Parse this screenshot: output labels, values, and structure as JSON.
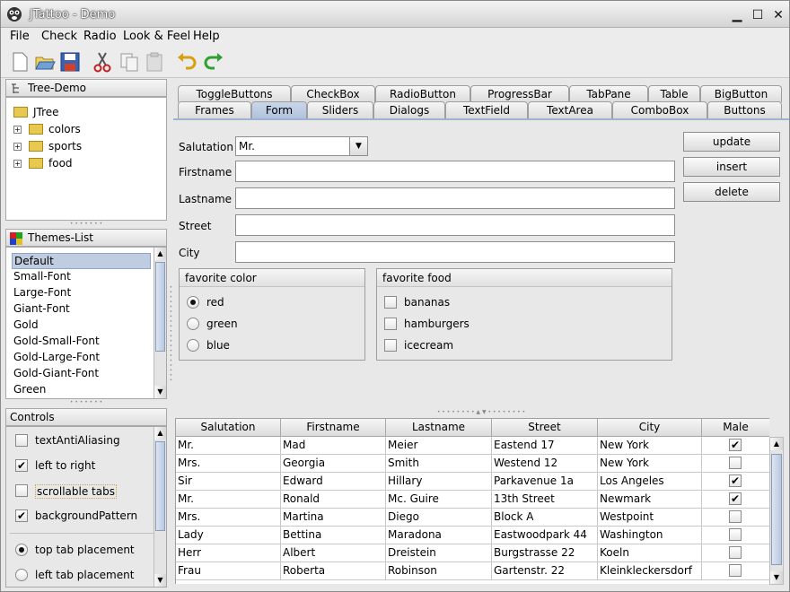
{
  "window": {
    "title": "JTattoo - Demo",
    "minimize": "▁",
    "maximize": "☐",
    "close": "✕"
  },
  "menubar": {
    "items": [
      "File",
      "Check",
      "Radio",
      "Look & Feel",
      "Help"
    ]
  },
  "toolbar": {
    "icons": [
      "new-file-icon",
      "open-folder-icon",
      "save-icon",
      "cut-icon",
      "copy-icon",
      "paste-icon",
      "undo-icon",
      "redo-icon"
    ]
  },
  "tree_panel": {
    "title": "Tree-Demo",
    "root": "JTree",
    "children": [
      "colors",
      "sports",
      "food"
    ],
    "expand_glyph": "+"
  },
  "themes_panel": {
    "title": "Themes-List",
    "items": [
      "Default",
      "Small-Font",
      "Large-Font",
      "Giant-Font",
      "Gold",
      "Gold-Small-Font",
      "Gold-Large-Font",
      "Gold-Giant-Font",
      "Green"
    ],
    "selected": "Default"
  },
  "controls_panel": {
    "title": "Controls",
    "checkboxes": [
      {
        "label": "textAntiAliasing",
        "checked": false,
        "mark": ""
      },
      {
        "label": "left to right",
        "checked": true,
        "mark": "✔"
      },
      {
        "label": "scrollable tabs",
        "checked": false,
        "mark": ""
      },
      {
        "label": "backgroundPattern",
        "checked": true,
        "mark": "✔"
      }
    ],
    "radios": [
      {
        "label": "top tab placement",
        "selected": true
      },
      {
        "label": "left tab placement",
        "selected": false
      }
    ]
  },
  "tabs": {
    "row1": [
      "ToggleButtons",
      "CheckBox",
      "RadioButton",
      "ProgressBar",
      "TabPane",
      "Table",
      "BigButton"
    ],
    "row2": [
      "Frames",
      "Form",
      "Sliders",
      "Dialogs",
      "TextField",
      "TextArea",
      "ComboBox",
      "Buttons"
    ],
    "selected": "Form"
  },
  "form": {
    "labels": {
      "salutation": "Salutation",
      "firstname": "Firstname",
      "lastname": "Lastname",
      "street": "Street",
      "city": "City"
    },
    "salutation_value": "Mr.",
    "buttons": {
      "update": "update",
      "insert": "insert",
      "delete": "delete"
    },
    "favorite_color": {
      "title": "favorite color",
      "options": [
        "red",
        "green",
        "blue"
      ],
      "selected": "red"
    },
    "favorite_food": {
      "title": "favorite food",
      "options": [
        "bananas",
        "hamburgers",
        "icecream"
      ]
    }
  },
  "table": {
    "columns": [
      "Salutation",
      "Firstname",
      "Lastname",
      "Street",
      "City",
      "Male"
    ],
    "rows": [
      {
        "salutation": "Mr.",
        "firstname": "Mad",
        "lastname": "Meier",
        "street": "Eastend 17",
        "city": "New York",
        "male": "✔"
      },
      {
        "salutation": "Mrs.",
        "firstname": "Georgia",
        "lastname": "Smith",
        "street": "Westend 12",
        "city": "New York",
        "male": ""
      },
      {
        "salutation": "Sir",
        "firstname": "Edward",
        "lastname": "Hillary",
        "street": "Parkavenue 1a",
        "city": "Los Angeles",
        "male": "✔"
      },
      {
        "salutation": "Mr.",
        "firstname": "Ronald",
        "lastname": "Mc. Guire",
        "street": "13th Street",
        "city": "Newmark",
        "male": "✔"
      },
      {
        "salutation": "Mrs.",
        "firstname": "Martina",
        "lastname": "Diego",
        "street": "Block A",
        "city": "Westpoint",
        "male": ""
      },
      {
        "salutation": "Lady",
        "firstname": "Bettina",
        "lastname": "Maradona",
        "street": "Eastwoodpark 44",
        "city": "Washington",
        "male": ""
      },
      {
        "salutation": "Herr",
        "firstname": "Albert",
        "lastname": "Dreistein",
        "street": "Burgstrasse 22",
        "city": "Koeln",
        "male": ""
      },
      {
        "salutation": "Frau",
        "firstname": "Roberta",
        "lastname": "Robinson",
        "street": "Gartenstr. 22",
        "city": "Kleinkleckersdorf",
        "male": ""
      }
    ]
  },
  "colors": {
    "selection": "#c0cce0",
    "tab_selected": "#b0c2dc",
    "accent": "#4e6ea8"
  }
}
